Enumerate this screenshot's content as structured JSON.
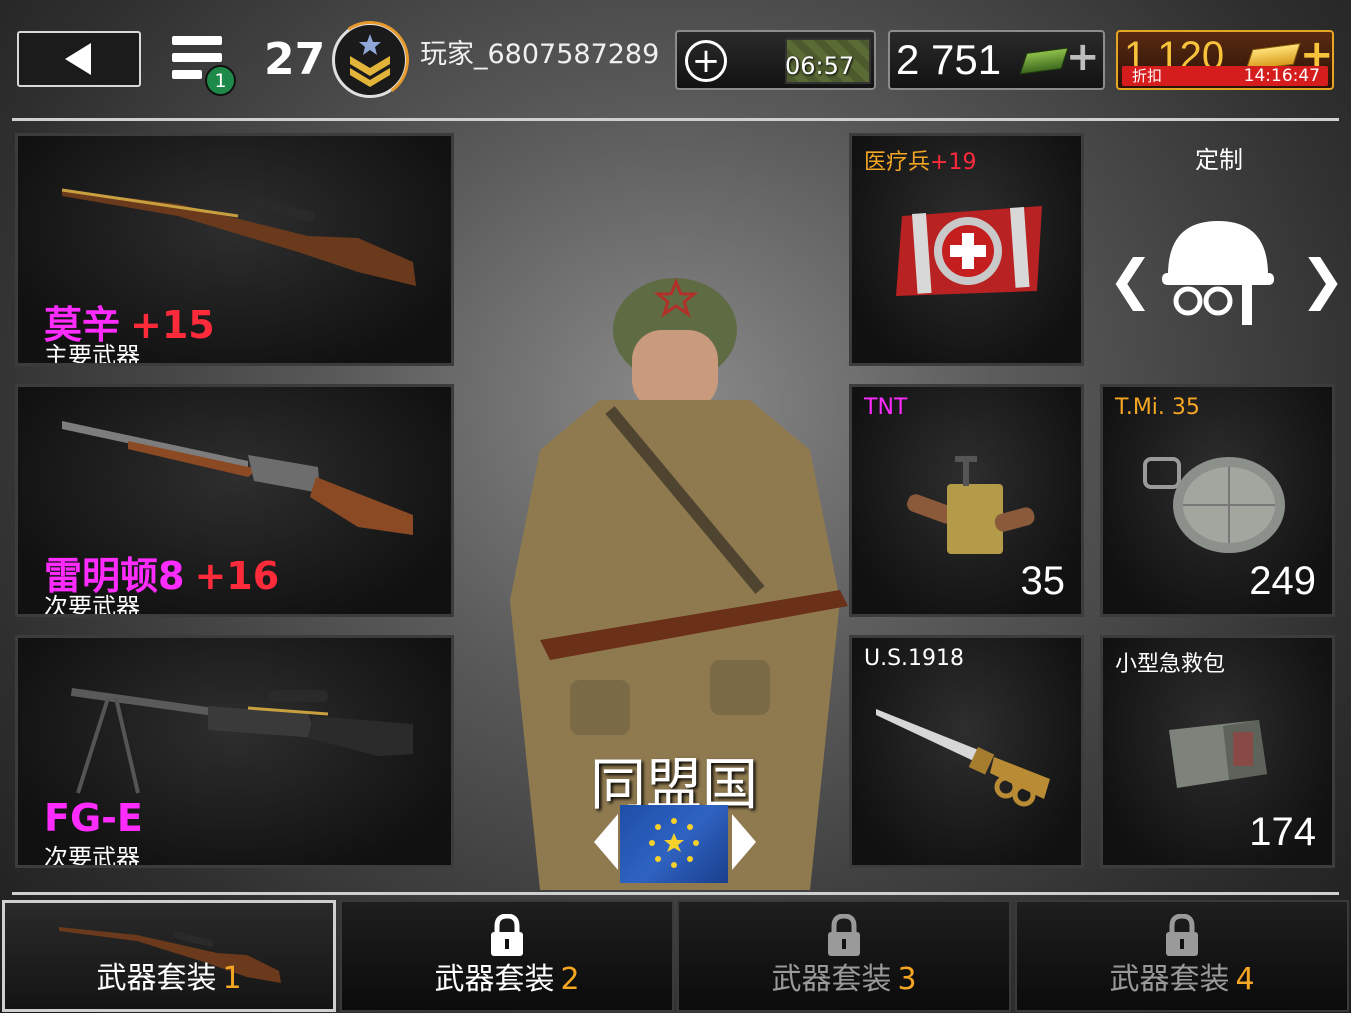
{
  "header": {
    "menu_badge": "1",
    "level": "27",
    "player_name": "玩家_6807587289",
    "crate_timer": "06:57",
    "cash": "2 751",
    "gold": "1 120",
    "discount_label": "折扣",
    "discount_timer": "14:16:47"
  },
  "weapons": [
    {
      "name": "莫辛",
      "bonus": "+15",
      "type": "主要武器"
    },
    {
      "name": "雷明顿8",
      "bonus": "+16",
      "type": "次要武器"
    },
    {
      "name": "FG-E",
      "bonus": "",
      "type": "次要武器"
    }
  ],
  "faction": {
    "name": "同盟国"
  },
  "items": {
    "perk": {
      "label": "医疗兵",
      "bonus": "+19"
    },
    "customize_title": "定制",
    "tnt": {
      "label": "TNT",
      "count": "35"
    },
    "mine": {
      "label": "T.Mi. 35",
      "count": "249"
    },
    "knife": {
      "label": "U.S.1918"
    },
    "medkit": {
      "label": "小型急救包",
      "count": "174"
    }
  },
  "tabs": [
    {
      "label": "武器套装",
      "num": "1",
      "state": "active"
    },
    {
      "label": "武器套装",
      "num": "2",
      "state": "locked"
    },
    {
      "label": "武器套装",
      "num": "3",
      "state": "locked"
    },
    {
      "label": "武器套装",
      "num": "4",
      "state": "locked"
    }
  ],
  "colors": {
    "weapon_name": "#ff2bff",
    "bonus": "#ff2a3a",
    "perk_label": "#f5a623",
    "gold": "#f7c33b",
    "discount": "#d61d1d",
    "tab_number": "#f5a623"
  },
  "icons": [
    "back-arrow-icon",
    "menu-icon",
    "rank-sergeant-icon",
    "add-icon",
    "crate-icon",
    "cash-icon",
    "gold-icon",
    "lock-icon",
    "helmet-icon",
    "medic-ribbon-icon"
  ]
}
